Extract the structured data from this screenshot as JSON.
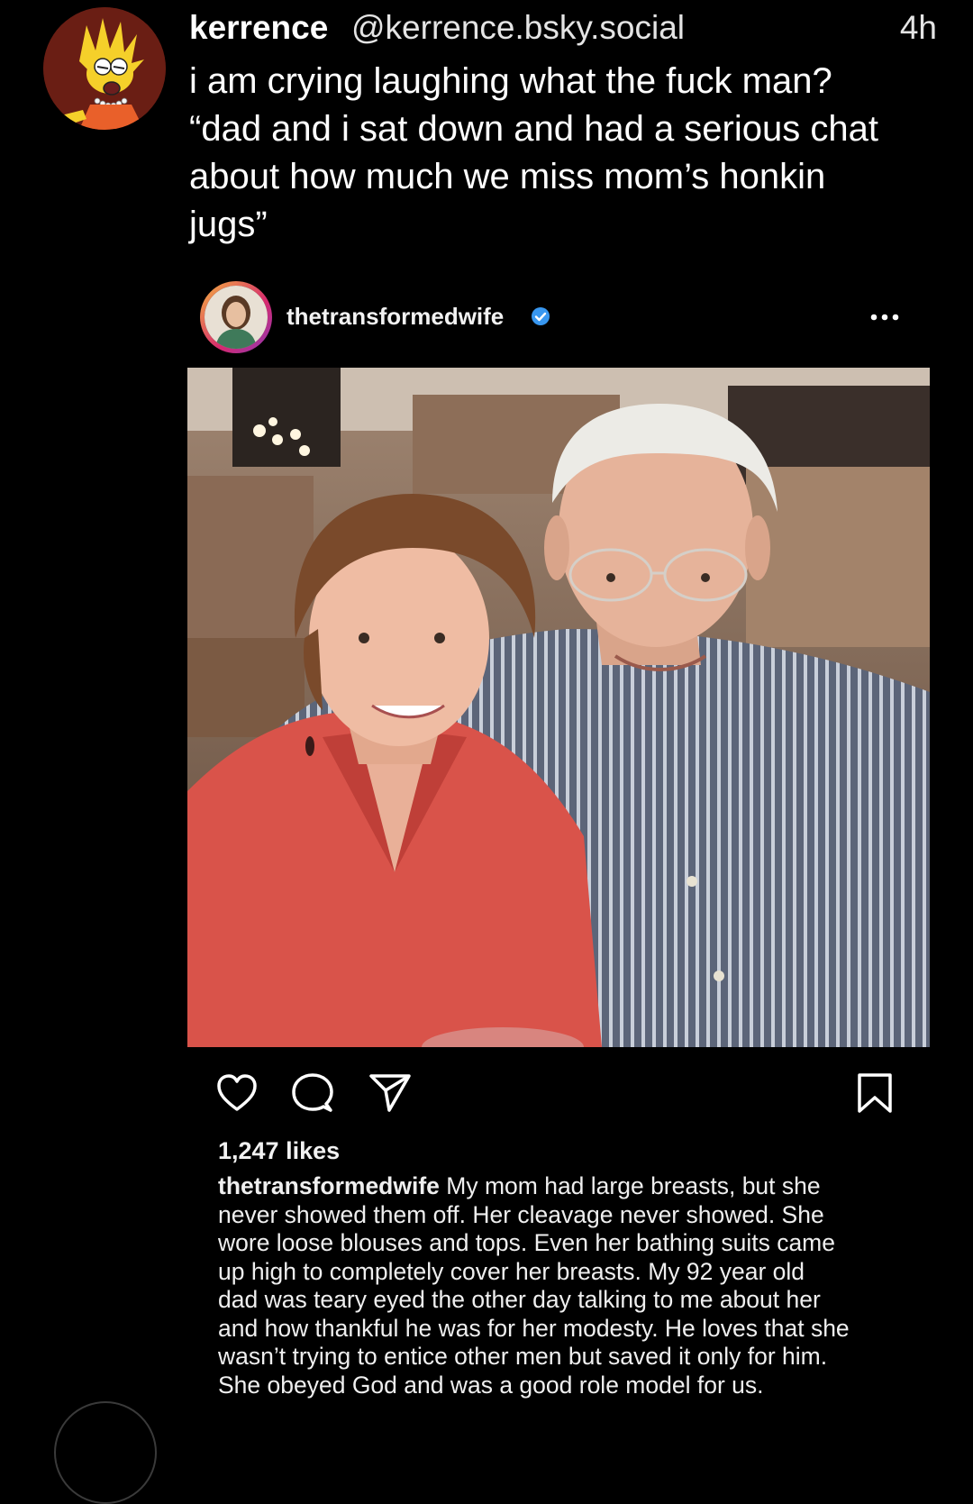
{
  "post": {
    "display_name": "kerrence",
    "handle": "@kerrence.bsky.social",
    "timestamp": "4h",
    "avatar_icon": "lisa-simpson-avatar",
    "text_lines": [
      "i am crying laughing what the fuck man?",
      "“dad and i sat down and had a serious chat",
      "about how much we miss mom’s honkin",
      "jugs”"
    ]
  },
  "embed": {
    "username": "thetransformedwife",
    "verified_icon": "verified-badge-icon",
    "more_icon": "more-options-icon",
    "photo_description_icon": "couple-photo",
    "actions": {
      "like_icon": "heart-icon",
      "comment_icon": "comment-icon",
      "share_icon": "send-icon",
      "save_icon": "bookmark-icon"
    },
    "likes": "1,247 likes",
    "caption_user": "thetransformedwife",
    "caption_lines": [
      " My mom had large breasts, but she",
      "never showed them off. Her cleavage never showed. She",
      "wore loose blouses and tops. Even her bathing suits came",
      "up high to completely cover her breasts. My 92 year old",
      "dad was teary eyed the other day talking to me about her",
      "and how thankful he was for her modesty. He loves that she",
      "wasn’t trying to entice other men but saved it only for him.",
      "She obeyed God and was a good role model for us."
    ]
  },
  "colors": {
    "background": "#000000",
    "text": "#ffffff",
    "verified": "#3897f0",
    "woman_shirt": "#d9534a",
    "man_shirt": "#5b6477"
  }
}
